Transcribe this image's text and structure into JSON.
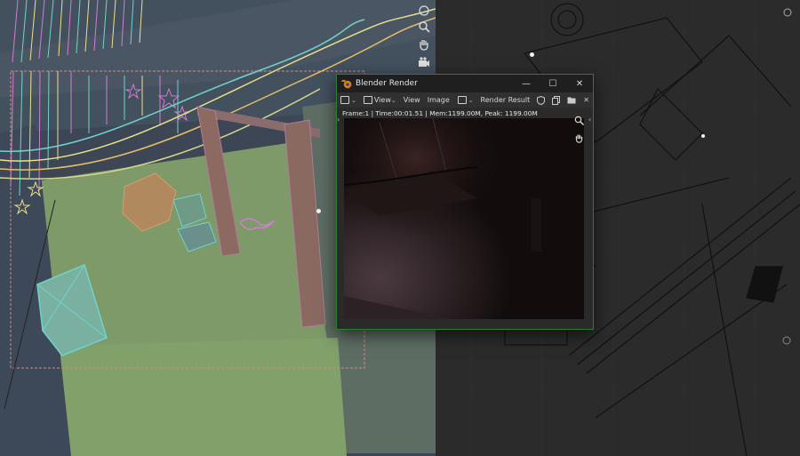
{
  "render_window": {
    "title": "Blender Render",
    "controls": {
      "minimize": "—",
      "maximize": "☐",
      "close": "✕"
    },
    "toolbar": {
      "view_menu_1": "View",
      "view_menu_2": "View",
      "image_menu": "Image",
      "slot_label": "Render Result"
    },
    "status": "Frame:1 | Time:00:01.51 | Mem:1199.00M, Peak: 1199.00M"
  },
  "icons": {
    "viewport_nav": [
      "globe-icon",
      "zoom-icon",
      "hand-icon",
      "camera-icon"
    ],
    "render_nav": [
      "zoom-icon",
      "hand-icon"
    ]
  },
  "colors": {
    "window_border": "#2e7d32",
    "titlebar": "#1f1f1f",
    "viewport_bg": "#3c4654",
    "floor": "#7e9a69",
    "render_bg": "#120c0c"
  }
}
